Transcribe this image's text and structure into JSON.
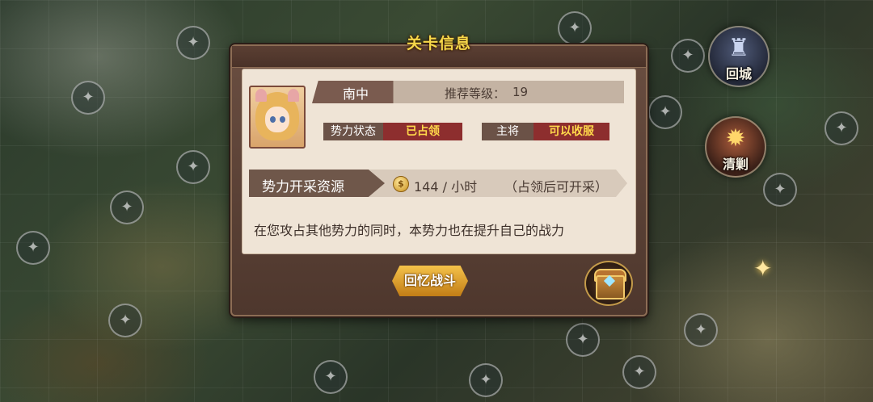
{
  "map": {
    "nodes": [
      "✦",
      "✦",
      "✦",
      "✦",
      "✦",
      "✦",
      "✦",
      "✦",
      "✦",
      "✦",
      "✦",
      "✦",
      "✦",
      "✦",
      "✦",
      "✦"
    ]
  },
  "side_buttons": {
    "return_label": "回城",
    "purge_label": "清剿"
  },
  "dialog": {
    "title": "关卡信息",
    "faction_name": "南中",
    "level_label": "推荐等级：",
    "level_value": "19",
    "state_label": "势力状态",
    "state_value": "已占领",
    "general_label": "主将",
    "general_value": "可以收服",
    "resource_title": "势力开采资源",
    "resource_amount": "144 / 小时",
    "resource_note": "（占领后可开采）",
    "description": "在您攻占其他势力的同时，本势力也在提升自己的战力",
    "recall_button": "回忆战斗"
  },
  "colors": {
    "title": "#f6d74a",
    "status_value_bg": "#8d2e2e",
    "status_value_text": "#ffd84a",
    "button": "#e0a030"
  }
}
